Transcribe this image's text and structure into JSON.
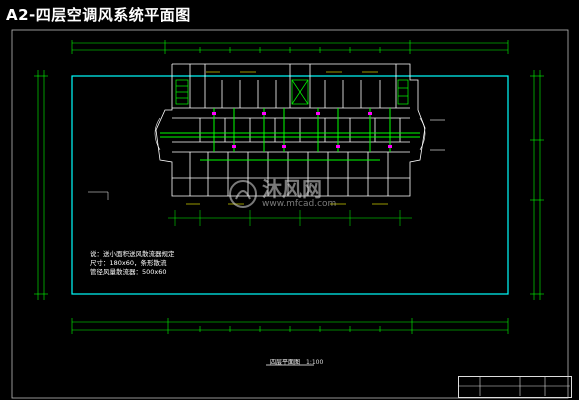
{
  "drawing": {
    "title": "A2-四层空调风系统平面图",
    "notes": [
      "说：送小面积送风散流器规定",
      "尺寸：180x60，条形散流",
      "管径风量散流器：500x60"
    ],
    "plan_label": "四层平面图",
    "scale": "1:100",
    "watermark_cn": "沐风网",
    "watermark_en": "www.mfcad.com"
  },
  "colors": {
    "background": "#000000",
    "building_outline": "#00ffff",
    "walls": "#ffffff",
    "ducts": "#00ff00",
    "dims": "#00ff00",
    "accent": "#ff00ff",
    "grid": "#ffff00"
  }
}
